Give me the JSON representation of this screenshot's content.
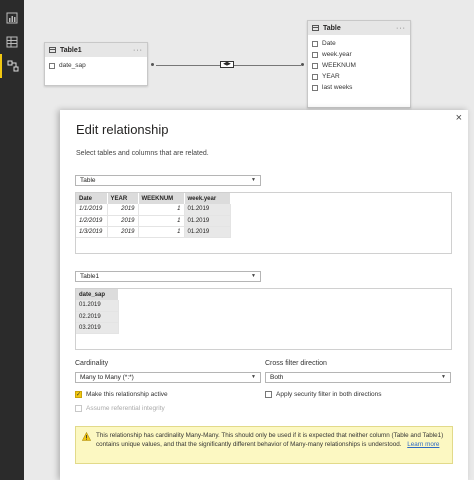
{
  "canvas": {
    "tables": [
      {
        "name": "Table1",
        "more": "···",
        "fields": [
          "date_sap"
        ]
      },
      {
        "name": "Table",
        "more": "···",
        "fields": [
          "Date",
          "week.year",
          "WEEKNUM",
          "YEAR",
          "last weeks"
        ]
      }
    ]
  },
  "dialog": {
    "close": "×",
    "title": "Edit relationship",
    "subtitle": "Select tables and columns that are related.",
    "table_a": {
      "selected": "Table",
      "columns": [
        "Date",
        "YEAR",
        "WEEKNUM",
        "week.year"
      ],
      "rows": [
        [
          "1/1/2019",
          "2019",
          "1",
          "01.2019"
        ],
        [
          "1/2/2019",
          "2019",
          "1",
          "01.2019"
        ],
        [
          "1/3/2019",
          "2019",
          "1",
          "01.2019"
        ]
      ]
    },
    "table_b": {
      "selected": "Table1",
      "columns": [
        "date_sap"
      ],
      "rows": [
        [
          "01.2019"
        ],
        [
          "02.2019"
        ],
        [
          "03.2019"
        ]
      ]
    },
    "cardinality": {
      "label": "Cardinality",
      "value": "Many to Many (*:*)"
    },
    "cross_filter": {
      "label": "Cross filter direction",
      "value": "Both"
    },
    "make_active": {
      "label": "Make this relationship active",
      "checked": true
    },
    "security_filter": {
      "label": "Apply security filter in both directions",
      "checked": false
    },
    "referential": {
      "label": "Assume referential integrity",
      "checked": false
    },
    "warning": {
      "text": "This relationship has cardinality Many-Many. This should only be used if it is expected that neither column (Table and Table1) contains unique values, and that the significantly different behavior of Many-many relationships is understood.",
      "link": "Learn more"
    }
  },
  "colors": {
    "accent": "#f2c811",
    "rail": "#2b2b2b",
    "warning_bg": "#fcf8c2",
    "link": "#2d69c4"
  }
}
